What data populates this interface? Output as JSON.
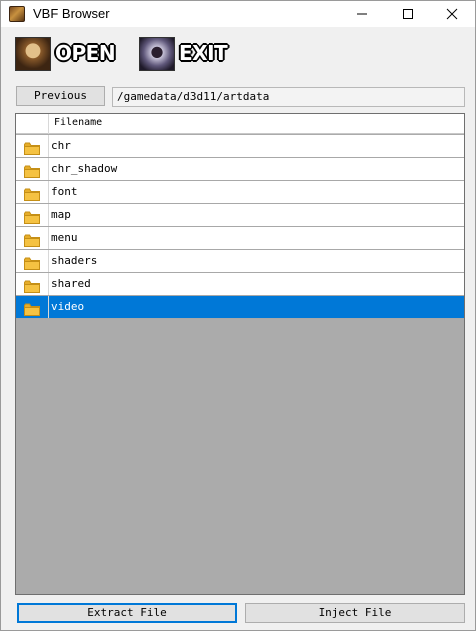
{
  "window": {
    "title": "VBF Browser"
  },
  "toolbar": {
    "open_label": "OPEN",
    "exit_label": "EXIT"
  },
  "nav": {
    "previous_label": "Previous",
    "path": "/gamedata/d3d11/artdata"
  },
  "list": {
    "column_header": "Filename",
    "items": [
      {
        "name": "chr",
        "icon": "folder-icon"
      },
      {
        "name": "chr_shadow",
        "icon": "folder-icon"
      },
      {
        "name": "font",
        "icon": "folder-icon"
      },
      {
        "name": "map",
        "icon": "folder-icon"
      },
      {
        "name": "menu",
        "icon": "folder-icon"
      },
      {
        "name": "shaders",
        "icon": "folder-icon"
      },
      {
        "name": "shared",
        "icon": "folder-icon"
      },
      {
        "name": "video",
        "icon": "folder-icon",
        "selected": true
      }
    ]
  },
  "actions": {
    "extract_label": "Extract File",
    "inject_label": "Inject File"
  },
  "colors": {
    "selection": "#0078d7",
    "list_background": "#ababab",
    "folder": "#f5c242"
  }
}
